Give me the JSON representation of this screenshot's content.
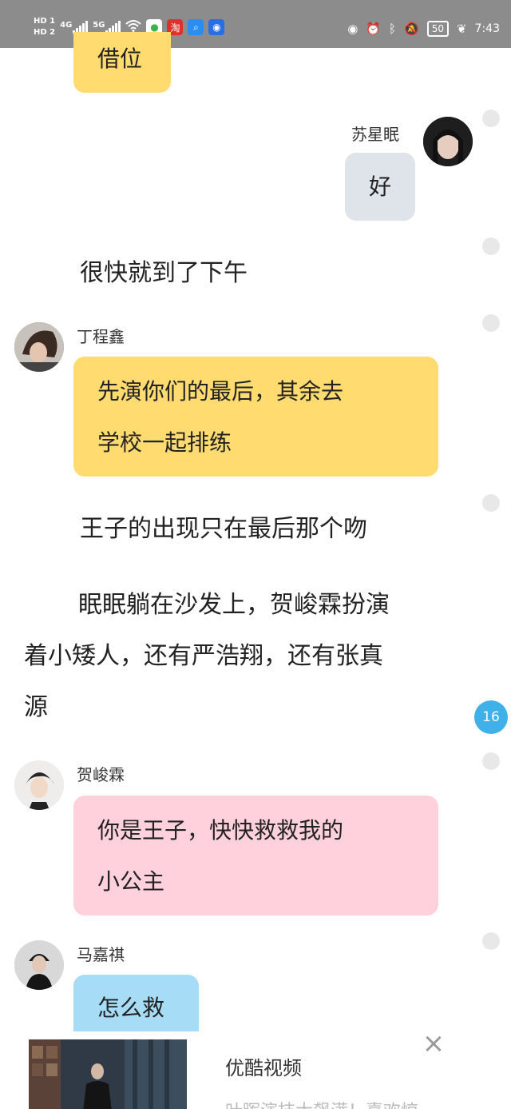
{
  "status_bar": {
    "hd1": "HD 1",
    "hd2": "HD 2",
    "net1": "4G",
    "net2": "5G",
    "battery": "50",
    "time": "7:43"
  },
  "messages": [
    {
      "type": "bubble",
      "text": "借位"
    },
    {
      "type": "bubble",
      "sender": "苏星眠",
      "text": "好"
    },
    {
      "type": "narration",
      "text": "很快就到了下午"
    },
    {
      "type": "bubble",
      "sender": "丁程鑫",
      "line1": "先演你们的最后，其余去",
      "line2": "学校一起排练"
    },
    {
      "type": "narration",
      "text": "王子的出现只在最后那个吻"
    },
    {
      "type": "narration",
      "line1": "眠眠躺在沙发上，贺峻霖扮演",
      "line2": "着小矮人，还有严浩翔，还有张真",
      "line3": "源"
    },
    {
      "type": "bubble",
      "sender": "贺峻霖",
      "line1": "你是王子，快快救救我的",
      "line2": "小公主"
    },
    {
      "type": "bubble",
      "sender": "马嘉祺",
      "text": "怎么救"
    }
  ],
  "badge": "16",
  "ad": {
    "title": "优酷视频",
    "desc": "叶晖演技大飙满！喜欢惊"
  }
}
